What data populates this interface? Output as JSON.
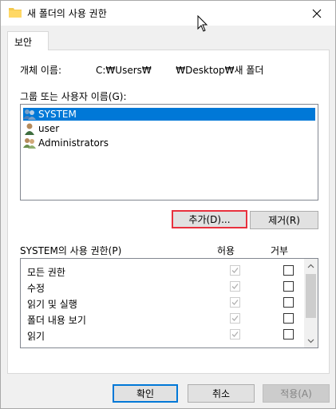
{
  "window": {
    "title": "새 폴더의 사용 권한"
  },
  "tabs": [
    {
      "label": "보안"
    }
  ],
  "object": {
    "label": "개체 이름:",
    "value": "C:₩Users₩        ₩Desktop₩새 폴더"
  },
  "groups": {
    "label": "그룹 또는 사용자 이름(G):",
    "items": [
      {
        "name": "SYSTEM",
        "icon": "users-group-icon",
        "selected": true
      },
      {
        "name": "user",
        "icon": "user-icon",
        "selected": false
      },
      {
        "name": "Administrators",
        "icon": "users-group-icon",
        "selected": false
      }
    ]
  },
  "buttons": {
    "add": "추가(D)...",
    "remove": "제거(R)",
    "ok": "확인",
    "cancel": "취소",
    "apply": "적용(A)"
  },
  "permissions": {
    "label": "SYSTEM의 사용 권한(P)",
    "allow_header": "허용",
    "deny_header": "거부",
    "rows": [
      {
        "name": "모든 권한",
        "allow": true,
        "deny": false
      },
      {
        "name": "수정",
        "allow": true,
        "deny": false
      },
      {
        "name": "읽기 및 실행",
        "allow": true,
        "deny": false
      },
      {
        "name": "폴더 내용 보기",
        "allow": true,
        "deny": false
      },
      {
        "name": "읽기",
        "allow": true,
        "deny": false
      }
    ]
  },
  "colors": {
    "selection": "#0078d7",
    "focus_border": "#e8313e"
  }
}
